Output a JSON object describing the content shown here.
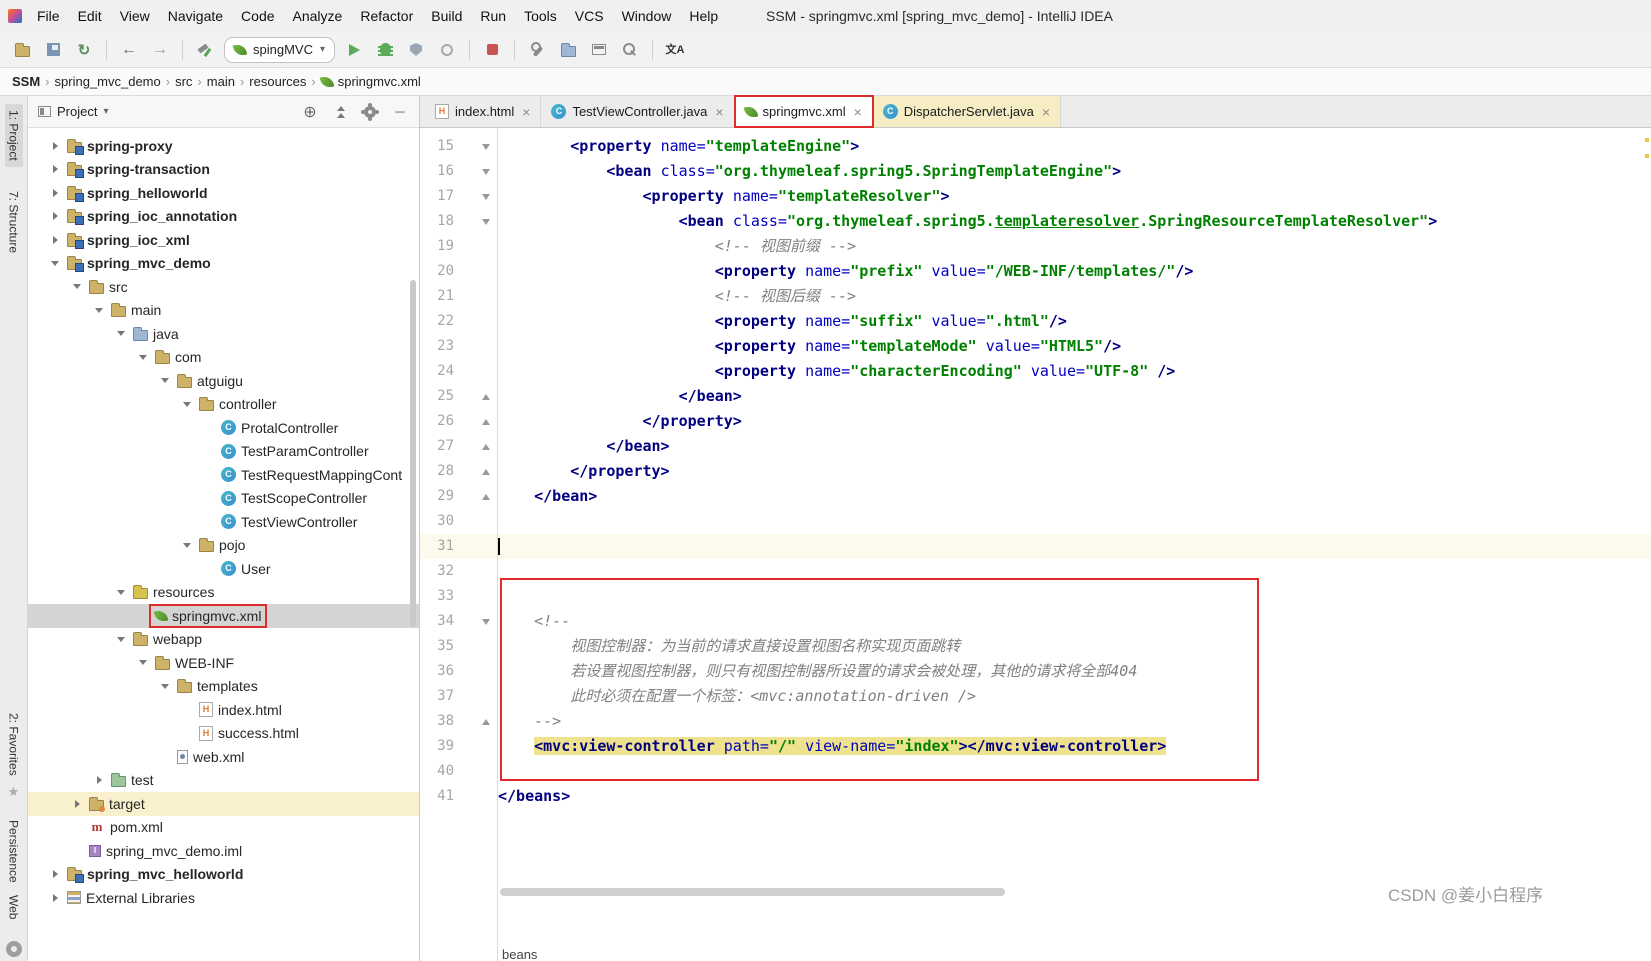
{
  "window_title": "SSM - springmvc.xml [spring_mvc_demo] - IntelliJ IDEA",
  "menubar": [
    "File",
    "Edit",
    "View",
    "Navigate",
    "Code",
    "Analyze",
    "Refactor",
    "Build",
    "Run",
    "Tools",
    "VCS",
    "Window",
    "Help"
  ],
  "toolbar": {
    "left_icons": [
      "open",
      "save",
      "sync",
      "sep",
      "back",
      "forward",
      "sep",
      "build"
    ],
    "run_config": "spingMVC",
    "right_icons": [
      "run",
      "debug",
      "coverage",
      "profiler",
      "sep",
      "stop",
      "sep",
      "wrench",
      "folder-blue",
      "frame",
      "search",
      "sep",
      "translate"
    ]
  },
  "breadcrumb": [
    "SSM",
    "spring_mvc_demo",
    "src",
    "main",
    "resources",
    "springmvc.xml"
  ],
  "tool_strip": {
    "top": [
      "1: Project",
      "7: Structure"
    ],
    "bottom": [
      "2: Favorites",
      "Persistence",
      "Web"
    ]
  },
  "project_panel": {
    "title": "Project",
    "icons": [
      "locate",
      "collapse",
      "settings",
      "hide"
    ]
  },
  "tree": [
    {
      "label": "spring-proxy",
      "indent": 0,
      "icon": "module",
      "arrow": "closed",
      "bold": true
    },
    {
      "label": "spring-transaction",
      "indent": 0,
      "icon": "module",
      "arrow": "closed",
      "bold": true
    },
    {
      "label": "spring_helloworld",
      "indent": 0,
      "icon": "module",
      "arrow": "closed",
      "bold": true
    },
    {
      "label": "spring_ioc_annotation",
      "indent": 0,
      "icon": "module",
      "arrow": "closed",
      "bold": true
    },
    {
      "label": "spring_ioc_xml",
      "indent": 0,
      "icon": "module",
      "arrow": "closed",
      "bold": true
    },
    {
      "label": "spring_mvc_demo",
      "indent": 0,
      "icon": "module",
      "arrow": "open",
      "bold": true
    },
    {
      "label": "src",
      "indent": 1,
      "icon": "folder",
      "arrow": "open"
    },
    {
      "label": "main",
      "indent": 2,
      "icon": "folder",
      "arrow": "open"
    },
    {
      "label": "java",
      "indent": 3,
      "icon": "folder-src",
      "arrow": "open"
    },
    {
      "label": "com",
      "indent": 4,
      "icon": "package",
      "arrow": "open"
    },
    {
      "label": "atguigu",
      "indent": 5,
      "icon": "package",
      "arrow": "open"
    },
    {
      "label": "controller",
      "indent": 6,
      "icon": "package",
      "arrow": "open"
    },
    {
      "label": "ProtalController",
      "indent": 7,
      "icon": "class"
    },
    {
      "label": "TestParamController",
      "indent": 7,
      "icon": "class"
    },
    {
      "label": "TestRequestMappingCont",
      "indent": 7,
      "icon": "class"
    },
    {
      "label": "TestScopeController",
      "indent": 7,
      "icon": "class"
    },
    {
      "label": "TestViewController",
      "indent": 7,
      "icon": "class"
    },
    {
      "label": "pojo",
      "indent": 6,
      "icon": "package",
      "arrow": "open"
    },
    {
      "label": "User",
      "indent": 7,
      "icon": "class"
    },
    {
      "label": "resources",
      "indent": 3,
      "icon": "folder-res",
      "arrow": "open"
    },
    {
      "label": "springmvc.xml",
      "indent": 4,
      "icon": "spring",
      "selected": true,
      "annotated": true
    },
    {
      "label": "webapp",
      "indent": 3,
      "icon": "folder",
      "arrow": "open"
    },
    {
      "label": "WEB-INF",
      "indent": 4,
      "icon": "folder",
      "arrow": "open"
    },
    {
      "label": "templates",
      "indent": 5,
      "icon": "folder",
      "arrow": "open"
    },
    {
      "label": "index.html",
      "indent": 6,
      "icon": "html"
    },
    {
      "label": "success.html",
      "indent": 6,
      "icon": "html"
    },
    {
      "label": "web.xml",
      "indent": 5,
      "icon": "web"
    },
    {
      "label": "test",
      "indent": 2,
      "icon": "folder-test",
      "arrow": "closed"
    },
    {
      "label": "target",
      "indent": 1,
      "icon": "folder-exc",
      "arrow": "closed",
      "row_highlight": true
    },
    {
      "label": "pom.xml",
      "indent": 1,
      "icon": "maven"
    },
    {
      "label": "spring_mvc_demo.iml",
      "indent": 1,
      "icon": "iml"
    },
    {
      "label": "spring_mvc_helloworld",
      "indent": 0,
      "icon": "module",
      "arrow": "closed",
      "bold": true
    },
    {
      "label": "External Libraries",
      "indent": 0,
      "icon": "lib",
      "arrow": "closed"
    }
  ],
  "tabs": [
    {
      "label": "index.html",
      "icon": "html"
    },
    {
      "label": "TestViewController.java",
      "icon": "class"
    },
    {
      "label": "springmvc.xml",
      "icon": "spring",
      "active": true
    },
    {
      "label": "DispatcherServlet.java",
      "icon": "class",
      "library": true
    }
  ],
  "editor": {
    "breadcrumb": "beans",
    "lines": [
      {
        "n": 15,
        "f": "d",
        "seg": [
          [
            "sp",
            "        "
          ],
          [
            "tag",
            "<property"
          ],
          [
            "sp",
            " "
          ],
          [
            "attr",
            "name="
          ],
          [
            "val",
            "\"templateEngine\""
          ],
          [
            "tag",
            ">"
          ]
        ]
      },
      {
        "n": 16,
        "f": "d",
        "seg": [
          [
            "sp",
            "            "
          ],
          [
            "tag",
            "<bean"
          ],
          [
            "sp",
            " "
          ],
          [
            "attr",
            "class="
          ],
          [
            "val",
            "\"org.thymeleaf.spring5.SpringTemplateEngine\""
          ],
          [
            "tag",
            ">"
          ]
        ]
      },
      {
        "n": 17,
        "f": "d",
        "seg": [
          [
            "sp",
            "                "
          ],
          [
            "tag",
            "<property"
          ],
          [
            "sp",
            " "
          ],
          [
            "attr",
            "name="
          ],
          [
            "val",
            "\"templateResolver\""
          ],
          [
            "tag",
            ">"
          ]
        ]
      },
      {
        "n": 18,
        "f": "d",
        "seg": [
          [
            "sp",
            "                    "
          ],
          [
            "tag",
            "<bean"
          ],
          [
            "sp",
            " "
          ],
          [
            "attr",
            "class="
          ],
          [
            "val",
            "\"org.thymeleaf.spring5."
          ],
          [
            "valu",
            "templateresolver"
          ],
          [
            "val",
            ".SpringResourceTemplateResolver\""
          ],
          [
            "tag",
            ">"
          ]
        ]
      },
      {
        "n": 19,
        "f": "",
        "seg": [
          [
            "sp",
            "                        "
          ],
          [
            "cm",
            "<!-- 视图前缀 -->"
          ]
        ]
      },
      {
        "n": 20,
        "f": "",
        "seg": [
          [
            "sp",
            "                        "
          ],
          [
            "tag",
            "<property"
          ],
          [
            "sp",
            " "
          ],
          [
            "attr",
            "name="
          ],
          [
            "val",
            "\"prefix\""
          ],
          [
            "sp",
            " "
          ],
          [
            "attr",
            "value="
          ],
          [
            "val",
            "\"/WEB-INF/templates/\""
          ],
          [
            "tag",
            "/>"
          ]
        ]
      },
      {
        "n": 21,
        "f": "",
        "seg": [
          [
            "sp",
            "                        "
          ],
          [
            "cm",
            "<!-- 视图后缀 -->"
          ]
        ]
      },
      {
        "n": 22,
        "f": "",
        "seg": [
          [
            "sp",
            "                        "
          ],
          [
            "tag",
            "<property"
          ],
          [
            "sp",
            " "
          ],
          [
            "attr",
            "name="
          ],
          [
            "val",
            "\"suffix\""
          ],
          [
            "sp",
            " "
          ],
          [
            "attr",
            "value="
          ],
          [
            "val",
            "\".html\""
          ],
          [
            "tag",
            "/>"
          ]
        ]
      },
      {
        "n": 23,
        "f": "",
        "seg": [
          [
            "sp",
            "                        "
          ],
          [
            "tag",
            "<property"
          ],
          [
            "sp",
            " "
          ],
          [
            "attr",
            "name="
          ],
          [
            "val",
            "\"templateMode\""
          ],
          [
            "sp",
            " "
          ],
          [
            "attr",
            "value="
          ],
          [
            "val",
            "\"HTML5\""
          ],
          [
            "tag",
            "/>"
          ]
        ]
      },
      {
        "n": 24,
        "f": "",
        "seg": [
          [
            "sp",
            "                        "
          ],
          [
            "tag",
            "<property"
          ],
          [
            "sp",
            " "
          ],
          [
            "attr",
            "name="
          ],
          [
            "val",
            "\"characterEncoding\""
          ],
          [
            "sp",
            " "
          ],
          [
            "attr",
            "value="
          ],
          [
            "val",
            "\"UTF-8\""
          ],
          [
            "sp",
            " "
          ],
          [
            "tag",
            "/>"
          ]
        ]
      },
      {
        "n": 25,
        "f": "u",
        "seg": [
          [
            "sp",
            "                    "
          ],
          [
            "tag",
            "</bean>"
          ]
        ]
      },
      {
        "n": 26,
        "f": "u",
        "seg": [
          [
            "sp",
            "                "
          ],
          [
            "tag",
            "</property>"
          ]
        ]
      },
      {
        "n": 27,
        "f": "u",
        "seg": [
          [
            "sp",
            "            "
          ],
          [
            "tag",
            "</bean>"
          ]
        ]
      },
      {
        "n": 28,
        "f": "u",
        "seg": [
          [
            "sp",
            "        "
          ],
          [
            "tag",
            "</property>"
          ]
        ]
      },
      {
        "n": 29,
        "f": "u",
        "seg": [
          [
            "sp",
            "    "
          ],
          [
            "tag",
            "</bean>"
          ]
        ]
      },
      {
        "n": 30,
        "f": "",
        "seg": []
      },
      {
        "n": 31,
        "f": "",
        "seg": [],
        "active": true,
        "caret": true
      },
      {
        "n": 32,
        "f": "",
        "seg": []
      },
      {
        "n": 33,
        "f": "",
        "seg": []
      },
      {
        "n": 34,
        "f": "d",
        "seg": [
          [
            "sp",
            "    "
          ],
          [
            "cm",
            "<!--"
          ]
        ]
      },
      {
        "n": 35,
        "f": "",
        "seg": [
          [
            "sp",
            "        "
          ],
          [
            "cm",
            "视图控制器：为当前的请求直接设置视图名称实现页面跳转"
          ]
        ]
      },
      {
        "n": 36,
        "f": "",
        "seg": [
          [
            "sp",
            "        "
          ],
          [
            "cm",
            "若设置视图控制器，则只有视图控制器所设置的请求会被处理，其他的请求将全部404"
          ]
        ]
      },
      {
        "n": 37,
        "f": "",
        "seg": [
          [
            "sp",
            "        "
          ],
          [
            "cm",
            "此时必须在配置一个标签：<mvc:annotation-driven />"
          ]
        ]
      },
      {
        "n": 38,
        "f": "u",
        "seg": [
          [
            "sp",
            "    "
          ],
          [
            "cm",
            "-->"
          ]
        ]
      },
      {
        "n": 39,
        "f": "",
        "hl": true,
        "seg": [
          [
            "sp",
            "    "
          ],
          [
            "tag",
            "<mvc:view-controller"
          ],
          [
            "sp",
            " "
          ],
          [
            "attr",
            "path="
          ],
          [
            "val",
            "\"/\""
          ],
          [
            "sp",
            " "
          ],
          [
            "attr",
            "view-name="
          ],
          [
            "val",
            "\"index\""
          ],
          [
            "tag",
            "></mvc:view-controller>"
          ]
        ]
      },
      {
        "n": 40,
        "f": "",
        "seg": []
      },
      {
        "n": 41,
        "f": "",
        "seg": [
          [
            "tag",
            "</beans>"
          ]
        ]
      }
    ]
  },
  "watermark": "CSDN @姜小白程序",
  "colors": {
    "annotation_red": "#e02b2b",
    "xml_tag": "#000080",
    "xml_attr": "#0000c0",
    "xml_value": "#008000",
    "comment_gray": "#808080",
    "line_highlight_yellow": "#efe28f",
    "caret_row": "#fcfaed",
    "selection_gray": "#d4d4d4",
    "excluded_row_yellow": "#f9f1cd",
    "spring_green": "#5fa134"
  }
}
